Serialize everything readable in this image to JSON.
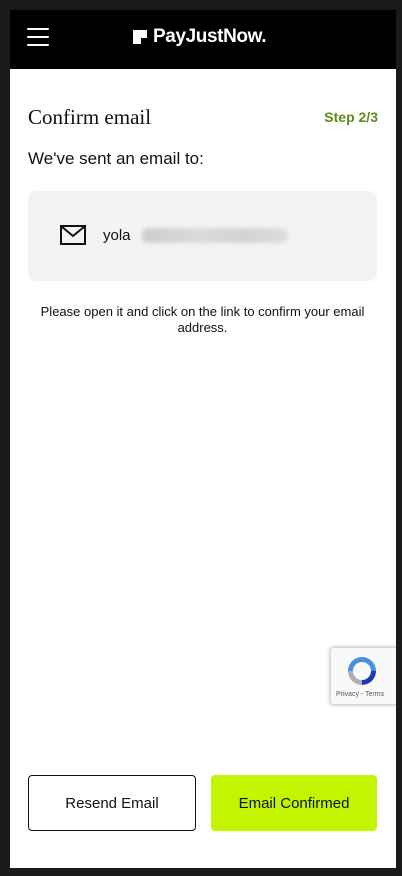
{
  "header": {
    "logo_text": "PayJustNow.",
    "menu_icon": "hamburger-menu-icon",
    "background": "#000000"
  },
  "page": {
    "title": "Confirm email",
    "step": "Step 2/3",
    "subtitle": "We've sent an email to:",
    "email_visible": "yola",
    "email_icon": "mail-icon",
    "info_text": "Please open it and click on the link to confirm your email address."
  },
  "recaptcha": {
    "links": "Privacy - Terms"
  },
  "actions": {
    "resend_label": "Resend Email",
    "confirm_label": "Email Confirmed",
    "accent_color": "#c4f500",
    "step_color": "#5f8a1e"
  }
}
